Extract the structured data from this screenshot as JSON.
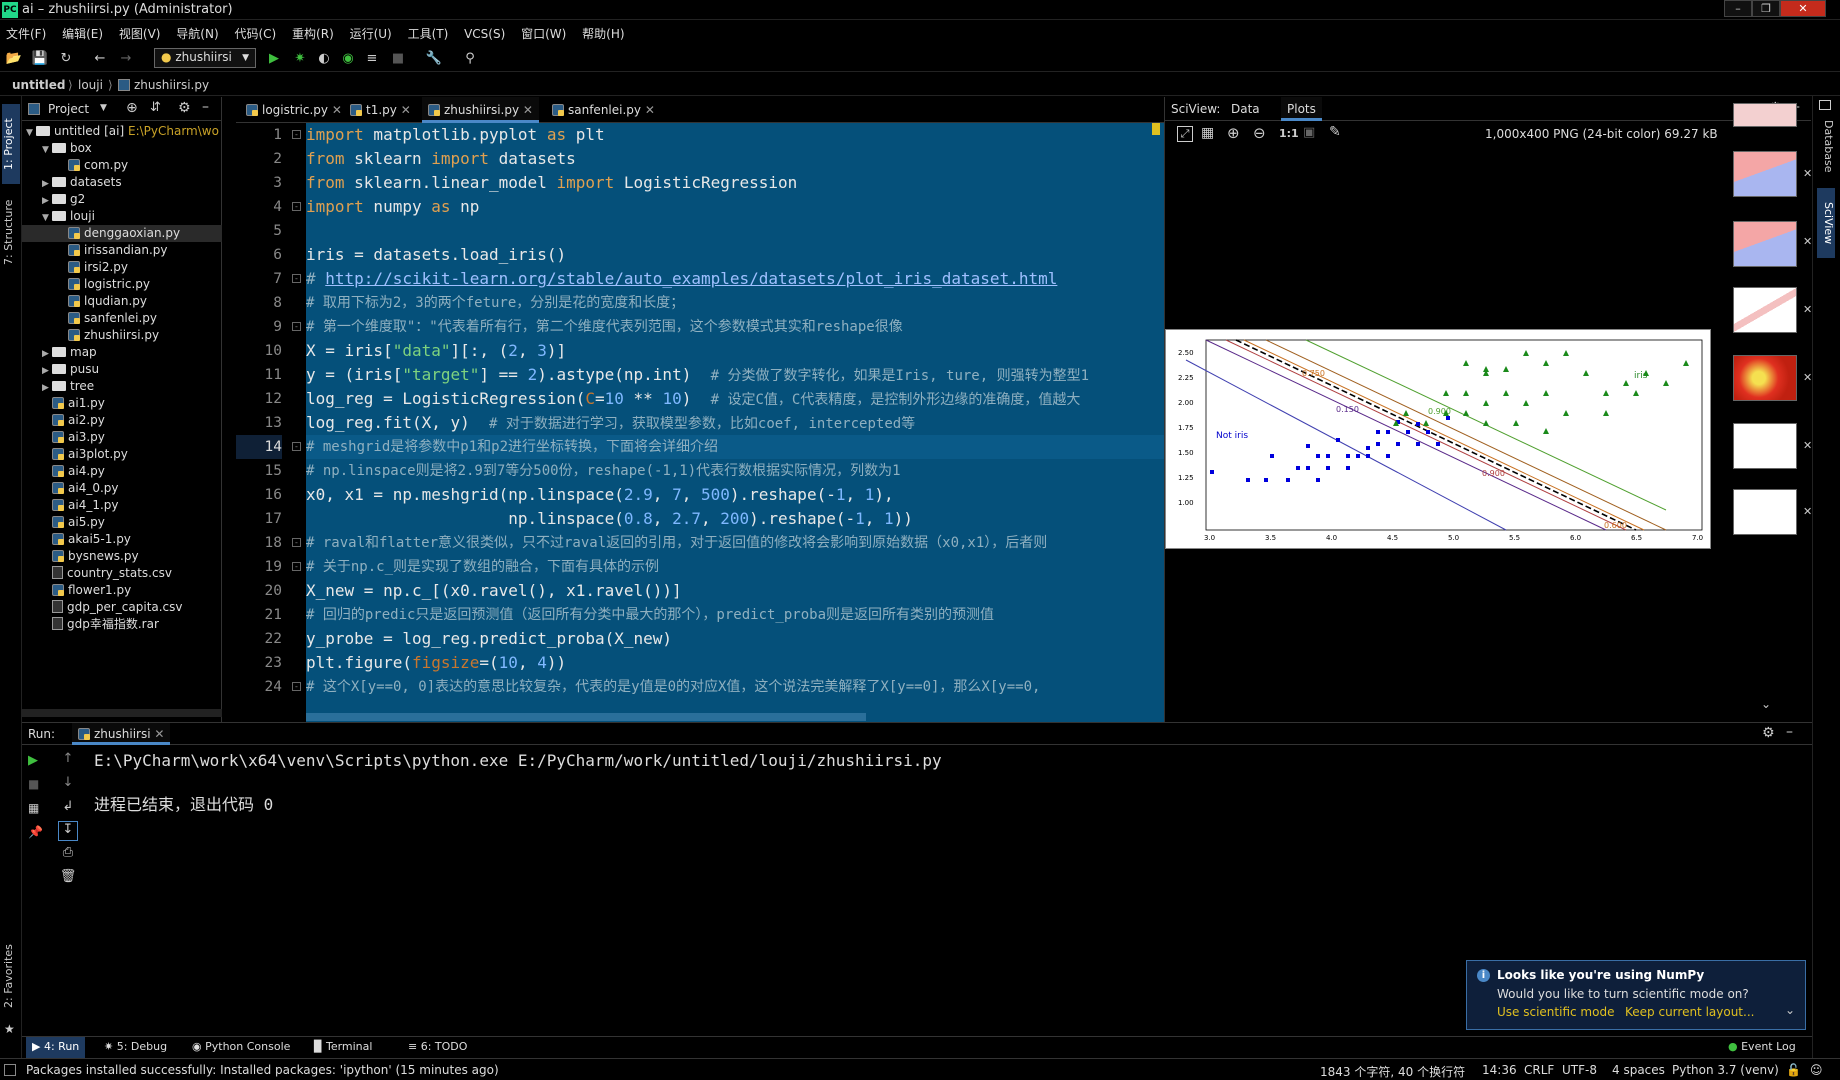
{
  "window": {
    "title": "ai – zhushiirsi.py (Administrator)",
    "app_icon": "PC"
  },
  "menu": [
    "文件(F)",
    "编辑(E)",
    "视图(V)",
    "导航(N)",
    "代码(C)",
    "重构(R)",
    "运行(U)",
    "工具(T)",
    "VCS(S)",
    "窗口(W)",
    "帮助(H)"
  ],
  "toolbar": {
    "run_config": "zhushiirsi"
  },
  "breadcrumb": [
    "untitled",
    "louji",
    "zhushiirsi.py"
  ],
  "left_strip": {
    "project": "1: Project",
    "structure": "7: Structure",
    "favorites": "2: Favorites"
  },
  "project": {
    "header": "Project",
    "items": [
      {
        "label": "untitled [ai]",
        "extra": "E:\\PyCharm\\wo",
        "type": "folder",
        "depth": 0,
        "open": true
      },
      {
        "label": "box",
        "type": "folder",
        "depth": 1,
        "open": true
      },
      {
        "label": "com.py",
        "type": "py",
        "depth": 2
      },
      {
        "label": "datasets",
        "type": "folder",
        "depth": 1,
        "open": false
      },
      {
        "label": "g2",
        "type": "folder",
        "depth": 1,
        "open": false
      },
      {
        "label": "louji",
        "type": "folder",
        "depth": 1,
        "open": true
      },
      {
        "label": "denggaoxian.py",
        "type": "py",
        "depth": 2,
        "selected": true
      },
      {
        "label": "irissandian.py",
        "type": "py",
        "depth": 2
      },
      {
        "label": "irsi2.py",
        "type": "py",
        "depth": 2
      },
      {
        "label": "logistric.py",
        "type": "py",
        "depth": 2
      },
      {
        "label": "lqudian.py",
        "type": "py",
        "depth": 2
      },
      {
        "label": "sanfenlei.py",
        "type": "py",
        "depth": 2
      },
      {
        "label": "zhushiirsi.py",
        "type": "py",
        "depth": 2
      },
      {
        "label": "map",
        "type": "folder",
        "depth": 1,
        "open": false
      },
      {
        "label": "pusu",
        "type": "folder",
        "depth": 1,
        "open": false
      },
      {
        "label": "tree",
        "type": "folder",
        "depth": 1,
        "open": false
      },
      {
        "label": "ai1.py",
        "type": "py",
        "depth": 1
      },
      {
        "label": "ai2.py",
        "type": "py",
        "depth": 1
      },
      {
        "label": "ai3.py",
        "type": "py",
        "depth": 1
      },
      {
        "label": "ai3plot.py",
        "type": "py",
        "depth": 1
      },
      {
        "label": "ai4.py",
        "type": "py",
        "depth": 1
      },
      {
        "label": "ai4_0.py",
        "type": "py",
        "depth": 1
      },
      {
        "label": "ai4_1.py",
        "type": "py",
        "depth": 1
      },
      {
        "label": "ai5.py",
        "type": "py",
        "depth": 1
      },
      {
        "label": "akai5-1.py",
        "type": "py",
        "depth": 1
      },
      {
        "label": "bysnews.py",
        "type": "py",
        "depth": 1
      },
      {
        "label": "country_stats.csv",
        "type": "csv",
        "depth": 1
      },
      {
        "label": "flower1.py",
        "type": "py",
        "depth": 1
      },
      {
        "label": "gdp_per_capita.csv",
        "type": "csv",
        "depth": 1
      },
      {
        "label": "gdp幸福指数.rar",
        "type": "csv",
        "depth": 1
      }
    ]
  },
  "editor": {
    "tabs": [
      "logistric.py",
      "t1.py",
      "zhushiirsi.py",
      "sanfenlei.py"
    ],
    "active_tab": 2,
    "current_line": 14,
    "line_numbers": [
      "1",
      "2",
      "3",
      "4",
      "5",
      "6",
      "7",
      "8",
      "9",
      "10",
      "11",
      "12",
      "13",
      "14",
      "15",
      "16",
      "17",
      "18",
      "19",
      "20",
      "21",
      "22",
      "23",
      "24"
    ],
    "code": {
      "l1a": "import",
      "l1b": " matplotlib.pyplot ",
      "l1c": "as",
      "l1d": " plt",
      "l2a": "from",
      "l2b": " sklearn ",
      "l2c": "import",
      "l2d": " datasets",
      "l3a": "from",
      "l3b": " sklearn.linear_model ",
      "l3c": "import",
      "l3d": " LogisticRegression",
      "l4a": "import",
      "l4b": " numpy ",
      "l4c": "as",
      "l4d": " np",
      "l6": "iris = datasets.load_iris()",
      "l7a": "# ",
      "l7b": "http://scikit-learn.org/stable/auto_examples/datasets/plot_iris_dataset.html",
      "l8": "# 取用下标为2，3的两个feture，分别是花的宽度和长度；",
      "l9": "# 第一个维度取\"：\"代表着所有行，第二个维度代表列范围，这个参数模式其实和reshape很像",
      "l10a": "X = iris[",
      "l10b": "\"data\"",
      "l10c": "][:, (",
      "l10d": "2",
      "l10e": ", ",
      "l10f": "3",
      "l10g": ")]",
      "l11a": "y = (iris[",
      "l11b": "\"target\"",
      "l11c": "] == ",
      "l11d": "2",
      "l11e": ").astype(np.int)  ",
      "l11f": "# 分类做了数字转化，如果是Iris, ture, 则强转为整型1",
      "l12a": "log_reg = LogisticRegression(",
      "l12b": "C",
      "l12c": "=",
      "l12d": "10",
      "l12e": " ** ",
      "l12f": "10",
      "l12g": ")  ",
      "l12h": "# 设定C值，C代表精度，是控制外形边缘的准确度，值越大",
      "l13a": "log_reg.fit(X, y)  ",
      "l13b": "# 对于数据进行学习，获取模型参数，比如coef, intercepted等",
      "l14": "# meshgrid是将参数中p1和p2进行坐标转换，下面将会详细介绍",
      "l15": "# np.linspace则是将2.9到7等分500份，reshape(-1,1)代表行数根据实际情况，列数为1",
      "l16a": "x0, x1 = np.meshgrid(np.linspace(",
      "l16b": "2.9",
      "l16c": ", ",
      "l16d": "7",
      "l16e": ", ",
      "l16f": "500",
      "l16g": ").reshape(-",
      "l16h": "1",
      "l16i": ", ",
      "l16j": "1",
      "l16k": "),",
      "l17a": "                     np.linspace(",
      "l17b": "0.8",
      "l17c": ", ",
      "l17d": "2.7",
      "l17e": ", ",
      "l17f": "200",
      "l17g": ").reshape(-",
      "l17h": "1",
      "l17i": ", ",
      "l17j": "1",
      "l17k": "))",
      "l18": "# raval和flatter意义很类似，只不过raval返回的引用，对于返回值的修改将会影响到原始数据（x0,x1），后者则",
      "l19": "# 关于np.c_则是实现了数组的融合，下面有具体的示例",
      "l20": "X_new = np.c_[(x0.ravel(), x1.ravel())]",
      "l21": "# 回归的predic只是返回预测值（返回所有分类中最大的那个），predict_proba则是返回所有类别的预测值",
      "l22": "y_probe = log_reg.predict_proba(X_new)",
      "l23a": "plt.figure(",
      "l23b": "figsize",
      "l23c": "=(",
      "l23d": "10",
      "l23e": ", ",
      "l23f": "4",
      "l23g": "))",
      "l24": "# 这个X[y==0, 0]表达的意思比较复杂，代表的是y值是0的对应X值，这个说法完美解释了X[y==0]，那么X[y==0,"
    }
  },
  "sciview": {
    "label": "SciView:",
    "tabs": [
      "Data",
      "Plots"
    ],
    "active_tab": "Plots",
    "image_info": "1,000x400 PNG (24-bit color) 69.27 kB",
    "zoom_label": "1:1"
  },
  "plot": {
    "y_ticks": [
      "2.50",
      "2.25",
      "2.00",
      "1.75",
      "1.50",
      "1.25",
      "1.00"
    ],
    "x_ticks": [
      "3.0",
      "3.5",
      "4.0",
      "4.5",
      "5.0",
      "5.5",
      "6.0",
      "6.5",
      "7.0"
    ],
    "label_iris": "iris",
    "label_not_iris": "Not iris",
    "contours": [
      "0.750",
      "0.150",
      "0.900",
      "0.900",
      "0.600"
    ]
  },
  "right_strip": [
    "Database",
    "SciView"
  ],
  "run": {
    "label": "Run:",
    "tab": "zhushiirsi",
    "cmd": "E:\\PyCharm\\work\\x64\\venv\\Scripts\\python.exe E:/PyCharm/work/untitled/louji/zhushiirsi.py",
    "exit": "进程已结束，退出代码 0"
  },
  "bottom_tabs": [
    "4: Run",
    "5: Debug",
    "Python Console",
    "Terminal",
    "6: TODO",
    "Event Log"
  ],
  "notification": {
    "title": "Looks like you're using NumPy",
    "body": "Would you like to turn scientific mode on?",
    "action1": "Use scientific mode",
    "action2": "Keep current layout..."
  },
  "status": {
    "message": "Packages installed successfully: Installed packages: 'ipython' (15 minutes ago)",
    "chars": "1843 个字符, 40 个换行符",
    "pos": "14:36",
    "eol": "CRLF",
    "enc": "UTF-8",
    "indent": "4 spaces",
    "interp": "Python 3.7 (venv)"
  },
  "colors": {
    "editor_bg": "#05507a",
    "accent": "#4a88c7",
    "notif_bg": "#0e1f3a"
  }
}
